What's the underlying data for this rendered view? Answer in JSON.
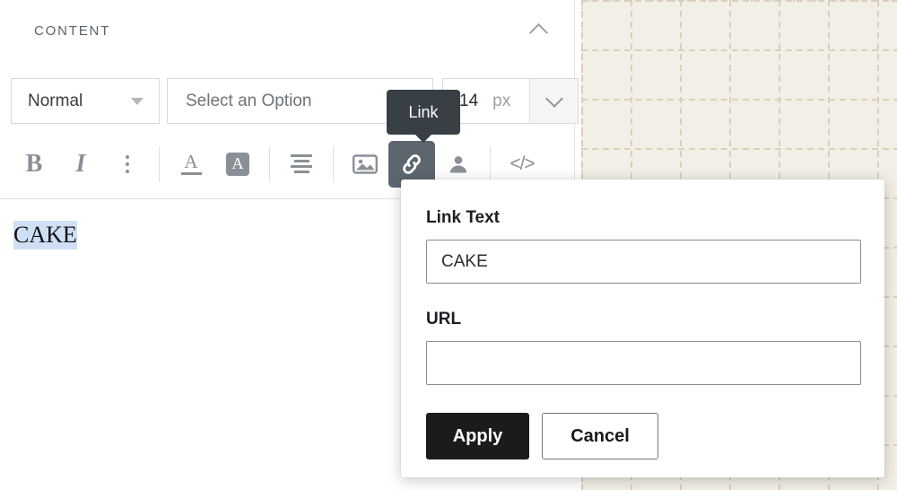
{
  "panel": {
    "section_title": "CONTENT",
    "collapse_icon": "chevron-up-icon"
  },
  "toolbar": {
    "style_select": {
      "value": "Normal",
      "icon": "triangle-down-icon"
    },
    "option_select": {
      "placeholder": "Select an Option",
      "value": ""
    },
    "font_size": {
      "value": "14",
      "unit": "px",
      "caret_icon": "chevron-down-icon"
    },
    "buttons": [
      {
        "name": "bold-button",
        "label": "B",
        "icon": "bold-icon",
        "active": false
      },
      {
        "name": "italic-button",
        "label": "I",
        "icon": "italic-icon",
        "active": false
      },
      {
        "name": "more-options-button",
        "label": "",
        "icon": "more-vertical-icon",
        "active": false
      },
      {
        "name": "text-color-button",
        "label": "A",
        "icon": "text-color-icon",
        "active": false
      },
      {
        "name": "highlight-color-button",
        "label": "A",
        "icon": "highlight-color-icon",
        "active": false
      },
      {
        "name": "align-button",
        "label": "",
        "icon": "align-icon",
        "active": false
      },
      {
        "name": "insert-image-button",
        "label": "",
        "icon": "image-icon",
        "active": false
      },
      {
        "name": "insert-link-button",
        "label": "",
        "icon": "link-icon",
        "active": true
      },
      {
        "name": "insert-personalization-button",
        "label": "",
        "icon": "person-icon",
        "active": false
      },
      {
        "name": "source-code-button",
        "label": "</>",
        "icon": "code-icon",
        "active": false
      }
    ]
  },
  "tooltip": {
    "text": "Link"
  },
  "editor": {
    "selected_text": "CAKE"
  },
  "link_dialog": {
    "link_text_label": "Link Text",
    "link_text_value": "CAKE",
    "link_text_placeholder": "",
    "url_label": "URL",
    "url_value": "",
    "url_placeholder": "",
    "apply_label": "Apply",
    "cancel_label": "Cancel"
  },
  "colors": {
    "tooltip_bg": "#383f45",
    "active_button_bg": "#5d666f",
    "apply_button_bg": "#1b1b1b",
    "selection_highlight": "#cfe0f5",
    "canvas_bg": "#f2efe6",
    "canvas_grid": "#d4caB6"
  }
}
